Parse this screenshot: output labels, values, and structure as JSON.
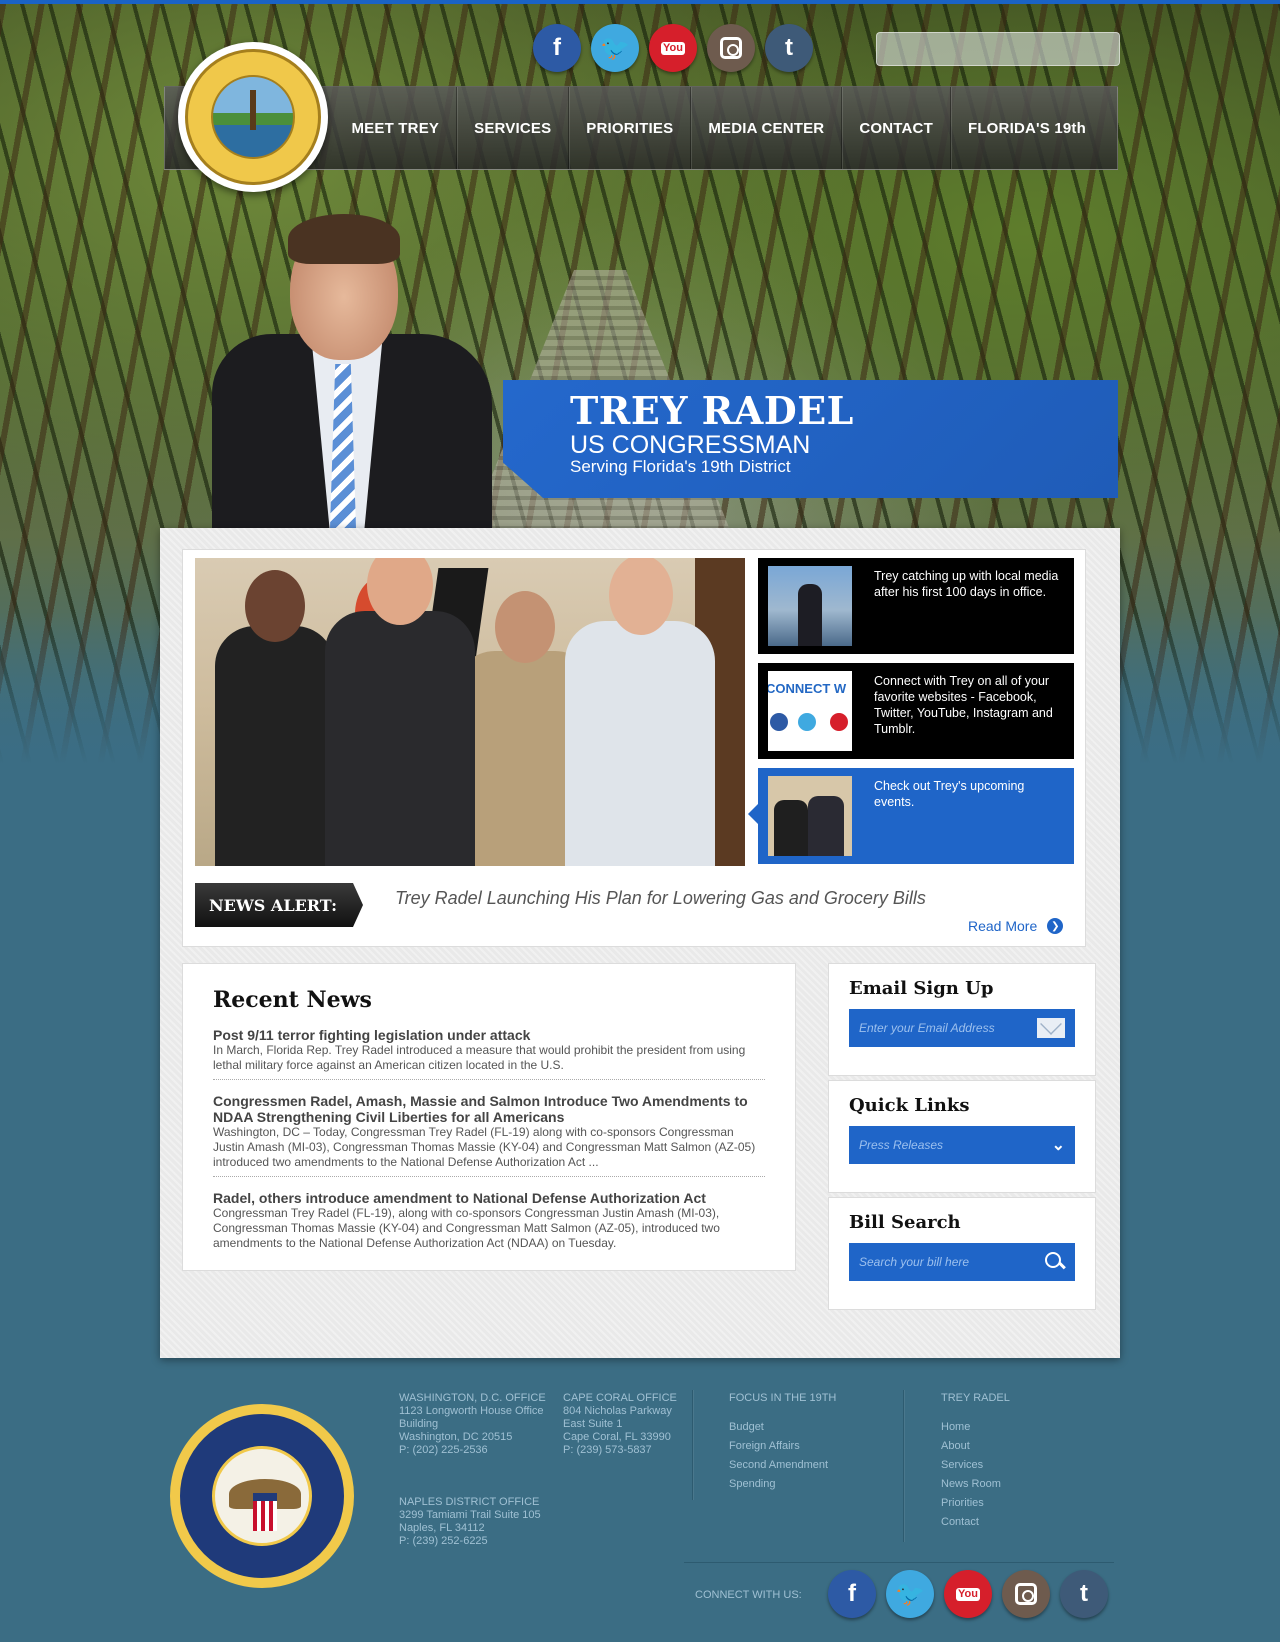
{
  "social_top": [
    {
      "icon": "facebook-icon",
      "glyph": "f"
    },
    {
      "icon": "twitter-icon",
      "glyph": "🐦"
    },
    {
      "icon": "youtube-icon",
      "glyph": "You"
    },
    {
      "icon": "instagram-icon",
      "glyph": ""
    },
    {
      "icon": "tumblr-icon",
      "glyph": "t"
    }
  ],
  "search": {
    "placeholder": ""
  },
  "nav": {
    "items": [
      "MEET TREY",
      "SERVICES",
      "PRIORITIES",
      "MEDIA CENTER",
      "CONTACT",
      "FLORIDA'S 19th"
    ]
  },
  "banner": {
    "name": "TREY RADEL",
    "title": "US CONGRESSMAN",
    "subtitle": "Serving Florida's 19th District"
  },
  "feature": {
    "cards": [
      {
        "text": "Trey catching up with local media after his first 100 days in office."
      },
      {
        "text": "Connect with Trey on all of your favorite websites - Facebook, Twitter, YouTube, Instagram and Tumblr.",
        "thumb_text": "CONNECT W"
      },
      {
        "text": "Check out Trey's upcoming events."
      }
    ],
    "alert_label": "NEWS ALERT:",
    "alert_text": "Trey Radel Launching His Plan for Lowering Gas and Grocery Bills",
    "read_more": "Read More"
  },
  "recent_news": {
    "heading": "Recent News",
    "items": [
      {
        "title": "Post 9/11 terror fighting legislation under attack",
        "body": "In March, Florida Rep. Trey Radel introduced a measure that would prohibit the president from using lethal military force against an American citizen located in the U.S."
      },
      {
        "title": "Congressmen Radel, Amash, Massie and Salmon Introduce Two Amendments to NDAA Strengthening Civil Liberties for all Americans",
        "body": "Washington, DC – Today, Congressman Trey Radel (FL-19) along with co-sponsors Congressman Justin Amash (MI-03), Congressman Thomas Massie (KY-04) and Congressman Matt Salmon (AZ-05) introduced two amendments to the National Defense Authorization Act ..."
      },
      {
        "title": "Radel, others introduce amendment to National Defense Authorization Act",
        "body": "Congressman Trey Radel (FL-19), along with co-sponsors Congressman Justin Amash (MI-03), Congressman Thomas Massie (KY-04) and Congressman Matt Salmon (AZ-05), introduced two amendments to the National Defense Authorization Act (NDAA) on Tuesday."
      }
    ]
  },
  "sidebar": {
    "email": {
      "heading": "Email Sign Up",
      "placeholder": "Enter your Email Address"
    },
    "quick_links": {
      "heading": "Quick Links",
      "selected": "Press Releases"
    },
    "bill_search": {
      "heading": "Bill Search",
      "placeholder": "Search your bill here"
    }
  },
  "footer": {
    "dc_office": {
      "title": "WASHINGTON, D.C. OFFICE",
      "lines": [
        "1123 Longworth House Office",
        "Building",
        "Washington, DC 20515",
        "P:  (202) 225-2536"
      ]
    },
    "cape_office": {
      "title": "CAPE CORAL OFFICE",
      "lines": [
        "804 Nicholas Parkway",
        "East Suite 1",
        "Cape Coral, FL 33990",
        "P:  (239) 573-5837"
      ]
    },
    "naples_office": {
      "title": "NAPLES DISTRICT OFFICE",
      "lines": [
        "3299 Tamiami Trail Suite 105",
        "Naples, FL 34112",
        "P:  (239) 252-6225"
      ]
    },
    "focus": {
      "title": "FOCUS IN THE 19TH",
      "links": [
        "Budget",
        "Foreign Affairs",
        "Second Amendment",
        "Spending"
      ]
    },
    "trey": {
      "title": "TREY RADEL",
      "links": [
        "Home",
        "About",
        "Services",
        "News Room",
        "Priorities",
        "Contact"
      ]
    },
    "connect_label": "CONNECT WITH US:"
  },
  "colors": {
    "brand_blue": "#1f65c8",
    "footer_bg": "#3b6d84"
  }
}
